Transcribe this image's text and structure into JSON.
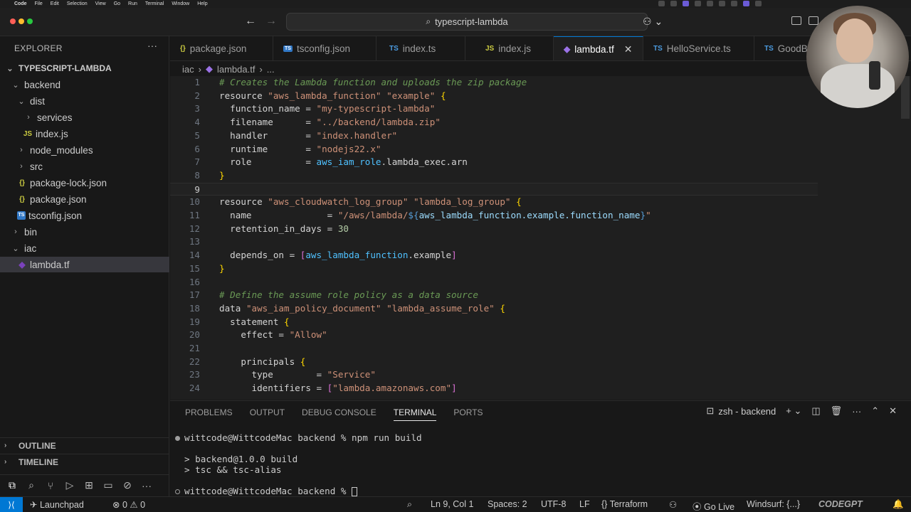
{
  "menubar": {
    "items": [
      "Code",
      "File",
      "Edit",
      "Selection",
      "View",
      "Go",
      "Run",
      "Terminal",
      "Window",
      "Help"
    ]
  },
  "titlebar": {
    "search_text": "typescript-lambda",
    "search_icon": "search-icon"
  },
  "explorer": {
    "title": "EXPLORER",
    "root": "TYPESCRIPT-LAMBDA",
    "items": [
      {
        "label": "backend",
        "type": "folder",
        "expanded": true
      },
      {
        "label": "dist",
        "type": "folder",
        "expanded": true
      },
      {
        "label": "services",
        "type": "folder",
        "expanded": false
      },
      {
        "label": "index.js",
        "type": "js"
      },
      {
        "label": "node_modules",
        "type": "folder",
        "expanded": false
      },
      {
        "label": "src",
        "type": "folder",
        "expanded": false
      },
      {
        "label": "package-lock.json",
        "type": "json"
      },
      {
        "label": "package.json",
        "type": "json"
      },
      {
        "label": "tsconfig.json",
        "type": "tsconfig"
      },
      {
        "label": "bin",
        "type": "folder",
        "expanded": false
      },
      {
        "label": "iac",
        "type": "folder",
        "expanded": true
      },
      {
        "label": "lambda.tf",
        "type": "tf",
        "selected": true
      }
    ],
    "outline": "OUTLINE",
    "timeline": "TIMELINE"
  },
  "tabs": [
    {
      "label": "package.json",
      "icon": "{}",
      "kind": "json"
    },
    {
      "label": "tsconfig.json",
      "icon": "TS",
      "kind": "tscfg"
    },
    {
      "label": "index.ts",
      "icon": "TS",
      "kind": "ts"
    },
    {
      "label": "index.js",
      "icon": "JS",
      "kind": "js"
    },
    {
      "label": "lambda.tf",
      "icon": "tf",
      "kind": "tf",
      "active": true
    },
    {
      "label": "HelloService.ts",
      "icon": "TS",
      "kind": "ts"
    },
    {
      "label": "GoodB",
      "icon": "TS",
      "kind": "ts"
    }
  ],
  "breadcrumb": {
    "folder": "iac",
    "file": "lambda.tf",
    "more": "..."
  },
  "code_lines": [
    "# Creates the Lambda function and uploads the zip package",
    "resource \"aws_lambda_function\" \"example\" {",
    "  function_name = \"my-typescript-lambda\"",
    "  filename      = \"../backend/lambda.zip\"",
    "  handler       = \"index.handler\"",
    "  runtime       = \"nodejs22.x\"",
    "  role          = aws_iam_role.lambda_exec.arn",
    "}",
    "",
    "resource \"aws_cloudwatch_log_group\" \"lambda_log_group\" {",
    "  name              = \"/aws/lambda/${aws_lambda_function.example.function_name}\"",
    "  retention_in_days = 30",
    "",
    "  depends_on = [aws_lambda_function.example]",
    "}",
    "",
    "# Define the assume role policy as a data source",
    "data \"aws_iam_policy_document\" \"lambda_assume_role\" {",
    "  statement {",
    "    effect = \"Allow\"",
    "",
    "    principals {",
    "      type        = \"Service\"",
    "      identifiers = [\"lambda.amazonaws.com\"]"
  ],
  "current_line": 9,
  "panel": {
    "tabs": [
      "PROBLEMS",
      "OUTPUT",
      "DEBUG CONSOLE",
      "TERMINAL",
      "PORTS"
    ],
    "active_tab": "TERMINAL",
    "shell_label": "zsh - backend",
    "terminal_lines": [
      "wittcode@WittcodeMac backend % npm run build",
      "",
      "> backend@1.0.0 build",
      "> tsc && tsc-alias",
      "",
      "wittcode@WittcodeMac backend % "
    ]
  },
  "statusbar": {
    "launchpad": "Launchpad",
    "errors": "0",
    "warnings": "0",
    "position": "Ln 9, Col 1",
    "spaces": "Spaces: 2",
    "encoding": "UTF-8",
    "eol": "LF",
    "language": "Terraform",
    "golive": "Go Live",
    "windsurf": "Windsurf: {...}",
    "codegpt": "CODEGPT"
  },
  "colors": {
    "accent": "#0078d4",
    "editor_bg": "#1f1f1f",
    "sidebar_bg": "#181818"
  }
}
